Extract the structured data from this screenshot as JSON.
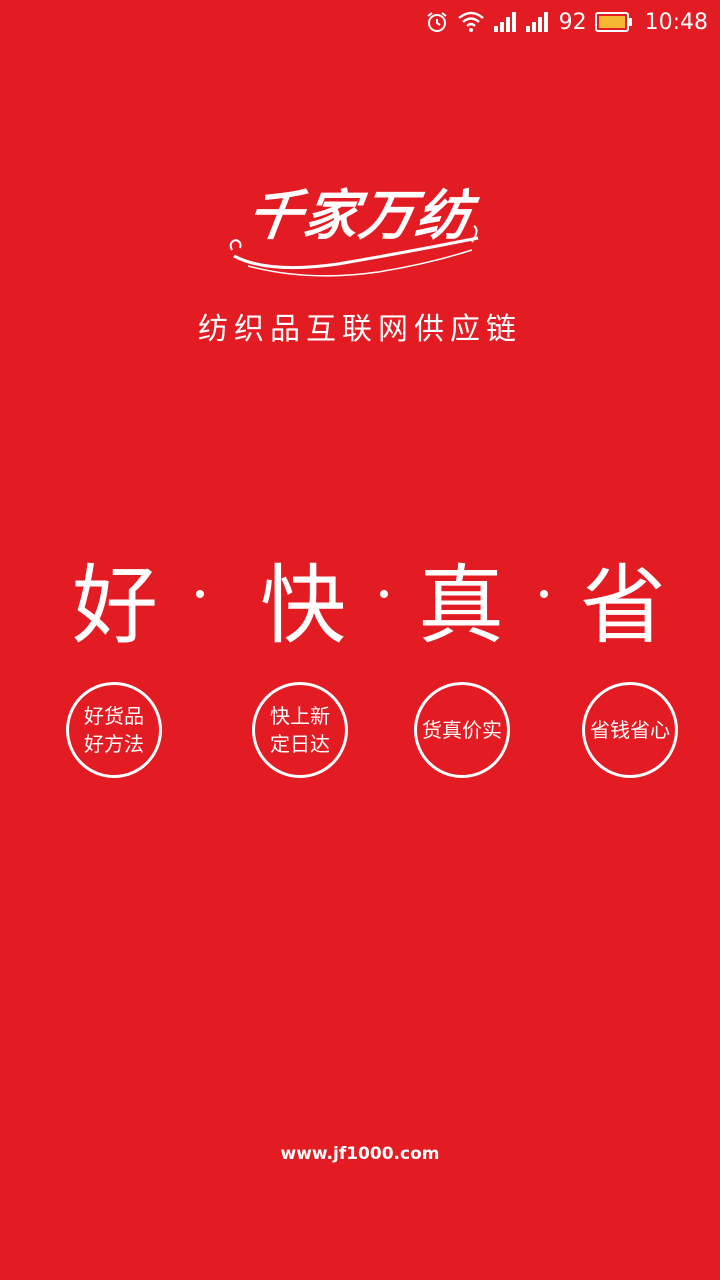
{
  "status_bar": {
    "battery_percent": "92",
    "time": "10:48",
    "icons": [
      "alarm-icon",
      "wifi-icon",
      "signal-icon",
      "signal-icon",
      "battery-icon"
    ]
  },
  "brand": {
    "logo_text": "千家万纺",
    "slogan": "纺织品互联网供应链"
  },
  "headline": {
    "chars": [
      "好",
      "快",
      "真",
      "省"
    ]
  },
  "features": [
    {
      "line1": "好货品",
      "line2": "好方法"
    },
    {
      "line1": "快上新",
      "line2": "定日达"
    },
    {
      "line1": "货真价实",
      "line2": ""
    },
    {
      "line1": "省钱省心",
      "line2": ""
    }
  ],
  "footer": {
    "url": "www.jf1000.com"
  },
  "colors": {
    "background": "#E31B23",
    "foreground": "#FFFFFF",
    "battery_fill": "#F7B733"
  }
}
